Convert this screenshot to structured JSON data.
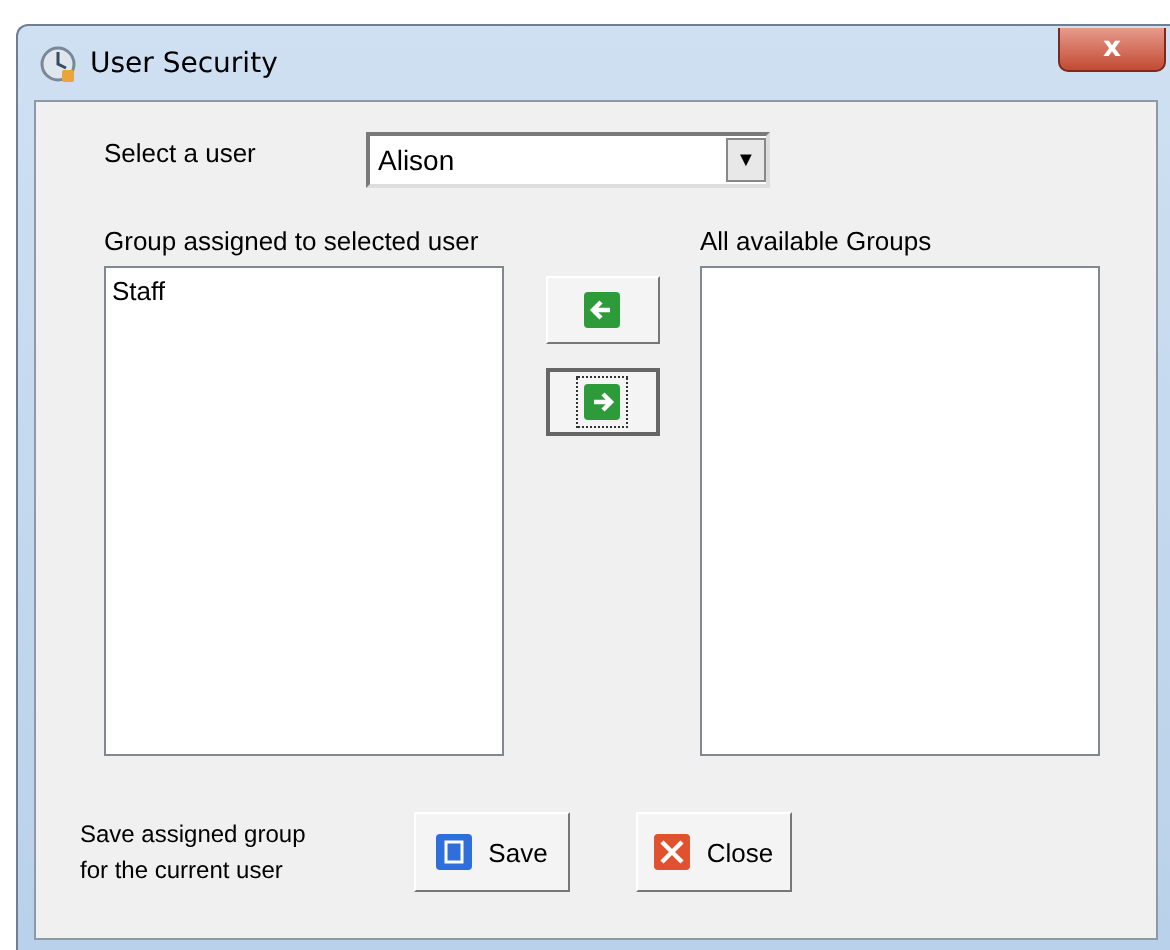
{
  "window": {
    "title": "User Security",
    "close_label": "x"
  },
  "user_select": {
    "label": "Select a user",
    "value": "Alison",
    "caret": "▼"
  },
  "assigned": {
    "label": "Group assigned to selected user",
    "items": [
      {
        "name": "Staff"
      }
    ]
  },
  "move_buttons": [
    {
      "kind": "left",
      "focused": false
    },
    {
      "kind": "right",
      "focused": true
    }
  ],
  "available": {
    "label": "All available Groups"
  },
  "footer": {
    "note": "Save assigned group\nfor the current user",
    "buttons": [
      {
        "kind": "save",
        "label": "Save"
      },
      {
        "kind": "close",
        "label": "Close"
      }
    ]
  }
}
